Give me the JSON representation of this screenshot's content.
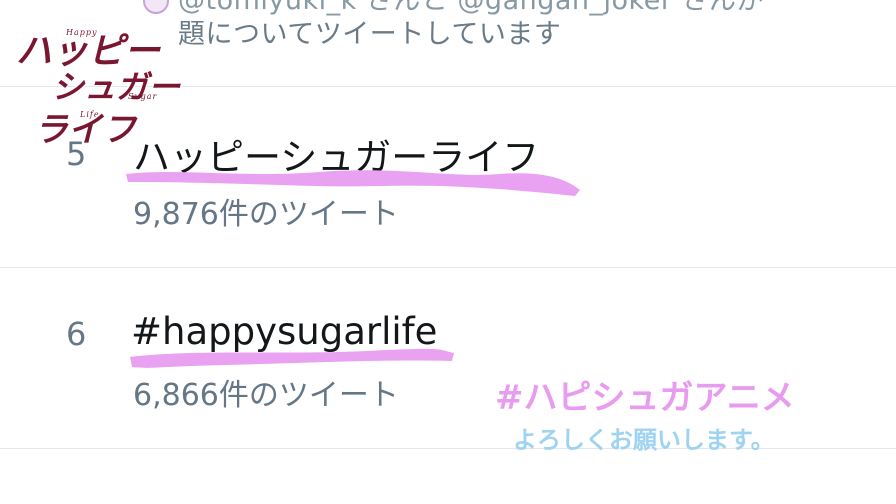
{
  "previous_trend": {
    "context_cut": "@tomiyuki_k さんと @gangan_joker さんが",
    "context": "題についてツイートしています"
  },
  "trends": [
    {
      "rank": "5",
      "name": "ハッピーシュガーライフ",
      "tweet_count": "9,876件のツイート"
    },
    {
      "rank": "6",
      "name": "#happysugarlife",
      "tweet_count": "6,866件のツイート"
    }
  ],
  "logo": {
    "line1": "ハッピー",
    "line2": "シュガー",
    "line3": "ライフ",
    "small_happy": "Happy",
    "small_sugar": "Sugar",
    "small_life": "Life"
  },
  "overlay": {
    "hashtag": "#ハピシュガアニメ",
    "message": "よろしくお願いします。"
  },
  "colors": {
    "highlight": "#e89cf0",
    "logo": "#7a1630",
    "secondary_text": "#657786"
  }
}
